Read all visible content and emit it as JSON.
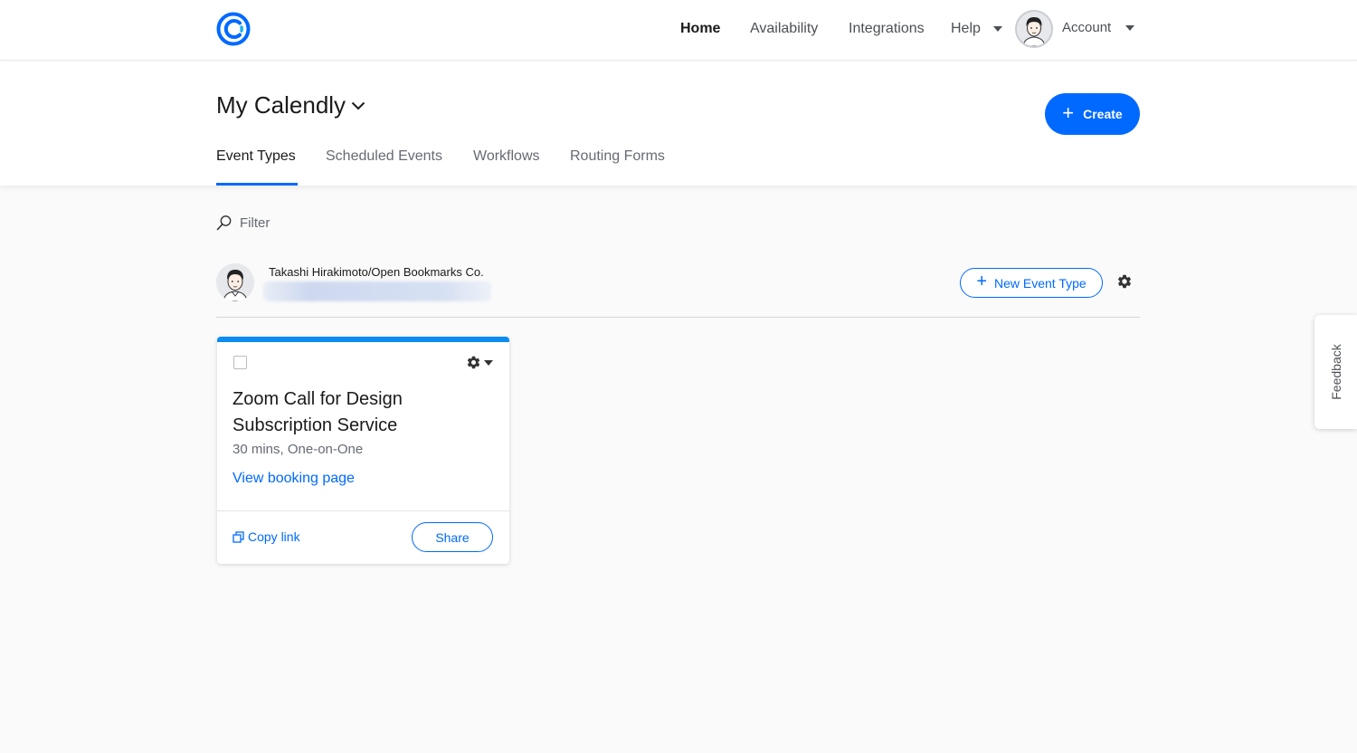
{
  "nav": {
    "links": [
      {
        "label": "Home"
      },
      {
        "label": "Availability"
      },
      {
        "label": "Integrations"
      },
      {
        "label": "Help"
      },
      {
        "label": "Account"
      }
    ]
  },
  "header": {
    "title": "My Calendly",
    "create_label": "Create",
    "tabs": [
      {
        "label": "Event Types",
        "active": true
      },
      {
        "label": "Scheduled Events"
      },
      {
        "label": "Workflows"
      },
      {
        "label": "Routing Forms"
      }
    ]
  },
  "filter": {
    "label": "Filter"
  },
  "user": {
    "name": "Takashi Hirakimoto/Open Bookmarks Co.",
    "new_event_label": "New Event Type"
  },
  "event_card": {
    "title": "Zoom Call for Design Subscription Service",
    "meta": "30 mins, One-on-One",
    "view_link": "View booking page",
    "copy_link": "Copy link",
    "share_label": "Share",
    "accent_color": "#0a8cf0"
  },
  "feedback": {
    "label": "Feedback"
  },
  "colors": {
    "primary": "#0069ff",
    "background": "#fafafa"
  }
}
